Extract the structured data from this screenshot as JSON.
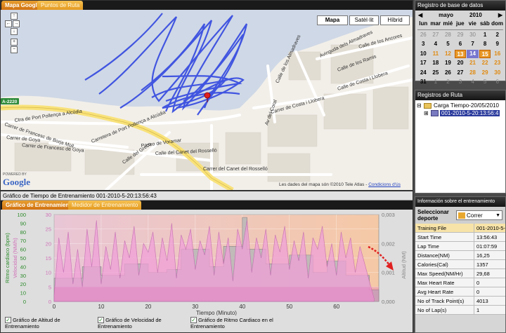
{
  "map": {
    "tabs": [
      "Mapa Google",
      "Puntos de Ruta"
    ],
    "map_types": [
      "Mapa",
      "Satèl·lit",
      "Híbrid"
    ],
    "road_badge": "A-2220",
    "streets": [
      "Ctra de Port Pollença a Alcúdia",
      "Carretera de Port Pollença a Alcúdia",
      "Carrer de Francesc de Borja Moll",
      "Carrer de Francesc de Goya",
      "Carrer de Goya",
      "Paseo de Voramar",
      "Carrer del Canet del Rosselló",
      "Calle del Canet del Rosselló",
      "Calle del Greco",
      "Carrer de Costa i Llobera",
      "Calle de Costa i Llobera",
      "Calle de los Almadraves",
      "Avinguda dels Almadraves",
      "Calle de los Ramis",
      "Calle de los Ancores",
      "Av del Coral"
    ],
    "attribution": "Les dades del mapa són ©2010 Tele Atlas -",
    "conditions": "Condicions d'ús",
    "powered_by": "POWERED BY",
    "google_logo": "Google"
  },
  "calendar": {
    "title": "Registro de base de datos",
    "month": "mayo",
    "year": "2010",
    "prev": "◀",
    "next": "▶",
    "weekdays": [
      "lun",
      "mar",
      "mié",
      "jue",
      "vie",
      "sáb",
      "dom"
    ],
    "days": [
      "26",
      "27",
      "28",
      "29",
      "30",
      "1",
      "2",
      "3",
      "4",
      "5",
      "6",
      "7",
      "8",
      "9",
      "10",
      "11",
      "12",
      "13",
      "14",
      "15",
      "16",
      "17",
      "18",
      "19",
      "20",
      "21",
      "22",
      "23",
      "24",
      "25",
      "26",
      "27",
      "28",
      "29",
      "30",
      "31",
      "1",
      "2",
      "3",
      "4",
      "5",
      "6"
    ]
  },
  "routes": {
    "title": "Registros de Ruta",
    "folder_label": "Carga Tiempo-20/05/2010",
    "item_label": "001-2010-5-20:13:56:4"
  },
  "info": {
    "title": "Información sobre el entrenamiento",
    "sport_label": "Seleccionar deporte",
    "sport_value": "Correr",
    "rows": [
      {
        "k": "Training File",
        "v": "001-2010-5-"
      },
      {
        "k": "Start Time",
        "v": "13:56:43"
      },
      {
        "k": "Lap Time",
        "v": "01:07:59"
      },
      {
        "k": "Distance(NM)",
        "v": "16,25"
      },
      {
        "k": "Calories(Cal)",
        "v": "1357"
      },
      {
        "k": "Max Speed(NM/Hr)",
        "v": "29,68"
      },
      {
        "k": "Max Heart Rate",
        "v": "0"
      },
      {
        "k": "Avg Heart Rate",
        "v": "0"
      },
      {
        "k": "No of Track Point(s)",
        "v": "4013"
      },
      {
        "k": "No of Lap(s)",
        "v": "1"
      }
    ]
  },
  "chart_panel": {
    "title": "Gráfico de Tiempo de Entrenamiento 001-2010-5-20:13:56:43",
    "tabs": [
      "Gráfico de Entrenamiento",
      "Medidor de Entrenamiento"
    ],
    "legend": [
      "Gráfico de Altitud de Entrenamiento",
      "Gráfico de Velocidad de Entrenamiento",
      "Gráfico de Ritmo Cardiaco en el Entrenamiento"
    ]
  },
  "chart_data": {
    "type": "area",
    "xlabel": "Tiempo (Minuto)",
    "ylabel_left_outer": "Ritmo cardiaco (bpm)",
    "ylabel_left_inner": "Velocidad (NM/h)",
    "ylabel_right": "Altitud (NM)",
    "x_ticks": [
      0,
      10,
      20,
      30,
      40,
      50,
      60
    ],
    "xlim": [
      0,
      69
    ],
    "hr_ticks": [
      0,
      10,
      20,
      30,
      40,
      50,
      60,
      70,
      80,
      90,
      100
    ],
    "speed_ticks": [
      0,
      5,
      10,
      15,
      20,
      25,
      30
    ],
    "alt_ticks": [
      "0,000",
      "0,001",
      "0,002",
      "0,003"
    ],
    "speed_ylim": [
      0,
      30
    ],
    "series": [
      {
        "name": "Velocidad",
        "x": [
          0,
          1,
          2,
          3,
          4,
          5,
          6,
          7,
          8,
          9,
          10,
          11,
          12,
          13,
          14,
          15,
          16,
          17,
          18,
          19,
          20,
          21,
          22,
          23,
          24,
          25,
          26,
          27,
          28,
          29,
          30,
          31,
          32,
          33,
          34,
          35,
          36,
          37,
          38,
          39,
          40,
          41,
          42,
          43,
          44,
          45,
          46,
          47,
          48,
          49,
          50,
          51,
          52,
          53,
          54,
          55,
          56,
          57,
          58,
          59,
          60,
          61,
          62,
          63,
          64,
          65,
          66,
          67,
          68
        ],
        "values": [
          2,
          22,
          10,
          24,
          6,
          18,
          5,
          25,
          12,
          28,
          6,
          19,
          11,
          24,
          8,
          21,
          15,
          26,
          9,
          20,
          17,
          24,
          10,
          22,
          14,
          27,
          8,
          23,
          18,
          25,
          11,
          21,
          16,
          26,
          9,
          24,
          13,
          22,
          7,
          25,
          18,
          28,
          10,
          22,
          15,
          25,
          9,
          23,
          17,
          26,
          11,
          21,
          14,
          24,
          8,
          22,
          18,
          26,
          12,
          20,
          9,
          24,
          15,
          22,
          10,
          19,
          13,
          7,
          1
        ]
      },
      {
        "name": "Altitud",
        "x": [
          0,
          6,
          6,
          10,
          10,
          15,
          15,
          20,
          20,
          24,
          24,
          27,
          27,
          33,
          33,
          36,
          36,
          40,
          40,
          41,
          41,
          45,
          45,
          50,
          50,
          55,
          55,
          58,
          58,
          62,
          62,
          67,
          67,
          69
        ],
        "values": [
          0.0008,
          0.0008,
          0.0012,
          0.0012,
          0.0009,
          0.0009,
          0.0013,
          0.0013,
          0.001,
          0.001,
          0.0011,
          0.0011,
          0.0018,
          0.0018,
          0.0012,
          0.0012,
          0.0019,
          0.0019,
          0.0029,
          0.0029,
          0.0018,
          0.0018,
          0.0013,
          0.0013,
          0.0016,
          0.0016,
          0.001,
          0.001,
          0.0014,
          0.0014,
          0.0009,
          0.0009,
          0.0004,
          0.0004
        ]
      }
    ]
  }
}
